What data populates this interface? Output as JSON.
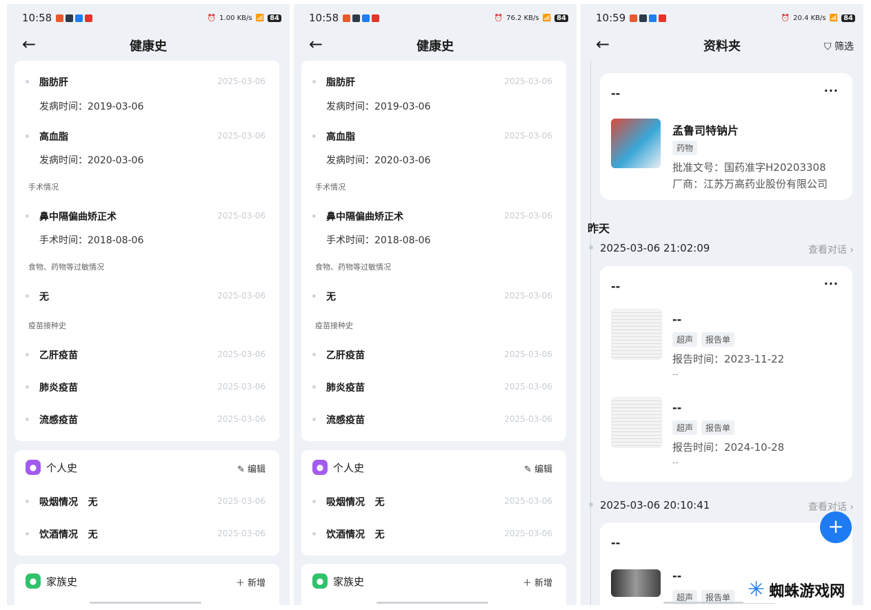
{
  "screens": [
    {
      "status": {
        "time": "10:58",
        "speed": "1.00 KB/s",
        "battery": "84"
      },
      "title": "健康史",
      "diseases": [
        {
          "name": "脂肪肝",
          "date": "2025-03-06",
          "onset": "发病时间：2019-03-06"
        },
        {
          "name": "高血脂",
          "date": "2025-03-06",
          "onset": "发病时间：2020-03-06"
        }
      ],
      "surgery_label": "手术情况",
      "surgery": {
        "name": "鼻中隔偏曲矫正术",
        "date": "2025-03-06",
        "time": "手术时间：2018-08-06"
      },
      "allergy_label": "食物、药物等过敏情况",
      "allergy": {
        "name": "无",
        "date": "2025-03-06"
      },
      "vaccine_label": "疫苗接种史",
      "vaccines": [
        {
          "name": "乙肝疫苗",
          "date": "2025-03-06"
        },
        {
          "name": "肺炎疫苗",
          "date": "2025-03-06"
        },
        {
          "name": "流感疫苗",
          "date": "2025-03-06"
        }
      ],
      "personal": {
        "title": "个人史",
        "action": "编辑",
        "items": [
          {
            "name": "吸烟情况   无",
            "date": "2025-03-06"
          },
          {
            "name": "饮酒情况   无",
            "date": "2025-03-06"
          }
        ]
      },
      "family": {
        "title": "家族史",
        "action": "新增"
      }
    },
    {
      "status": {
        "time": "10:58",
        "speed": "76.2 KB/s",
        "battery": "84"
      },
      "title": "健康史",
      "diseases": [
        {
          "name": "脂肪肝",
          "date": "2025-03-06",
          "onset": "发病时间：2019-03-06"
        },
        {
          "name": "高血脂",
          "date": "2025-03-06",
          "onset": "发病时间：2020-03-06"
        }
      ],
      "surgery_label": "手术情况",
      "surgery": {
        "name": "鼻中隔偏曲矫正术",
        "date": "2025-03-06",
        "time": "手术时间：2018-08-06"
      },
      "allergy_label": "食物、药物等过敏情况",
      "allergy": {
        "name": "无",
        "date": "2025-03-06"
      },
      "vaccine_label": "疫苗接种史",
      "vaccines": [
        {
          "name": "乙肝疫苗",
          "date": "2025-03-06"
        },
        {
          "name": "肺炎疫苗",
          "date": "2025-03-06"
        },
        {
          "name": "流感疫苗",
          "date": "2025-03-06"
        }
      ],
      "personal": {
        "title": "个人史",
        "action": "编辑",
        "items": [
          {
            "name": "吸烟情况   无",
            "date": "2025-03-06"
          },
          {
            "name": "饮酒情况   无",
            "date": "2025-03-06"
          }
        ]
      },
      "family": {
        "title": "家族史",
        "action": "新增"
      }
    }
  ],
  "folder": {
    "status": {
      "time": "10:59",
      "speed": "20.4 KB/s",
      "battery": "84"
    },
    "title": "资料夹",
    "filter": "筛选",
    "card1": {
      "dash": "--",
      "name": "孟鲁司特钠片",
      "tag": "药物",
      "approval": "批准文号：国药准字H20203308",
      "maker": "厂商：江苏万高药业股份有限公司"
    },
    "day_label": "昨天",
    "entries": [
      {
        "ts": "2025-03-06 21:02:09",
        "talk": "查看对话",
        "dash": "--",
        "items": [
          {
            "dash": "--",
            "tags": [
              "超声",
              "报告单"
            ],
            "time": "报告时间：2023-11-22",
            "sub": "--"
          },
          {
            "dash": "--",
            "tags": [
              "超声",
              "报告单"
            ],
            "time": "报告时间：2024-10-28",
            "sub": "--"
          }
        ]
      },
      {
        "ts": "2025-03-06 20:10:41",
        "talk": "查看对话",
        "dash": "--",
        "items": [
          {
            "dash": "--",
            "tags": [
              "超声",
              "报告单"
            ]
          }
        ]
      }
    ],
    "fab": "+"
  },
  "watermark": "蜘蛛游戏网",
  "colors": {
    "accent": "#1e7bf2",
    "personal_icon": "#a35bf0",
    "family_icon": "#2fc26b",
    "page_bg": "#eef2f7"
  }
}
